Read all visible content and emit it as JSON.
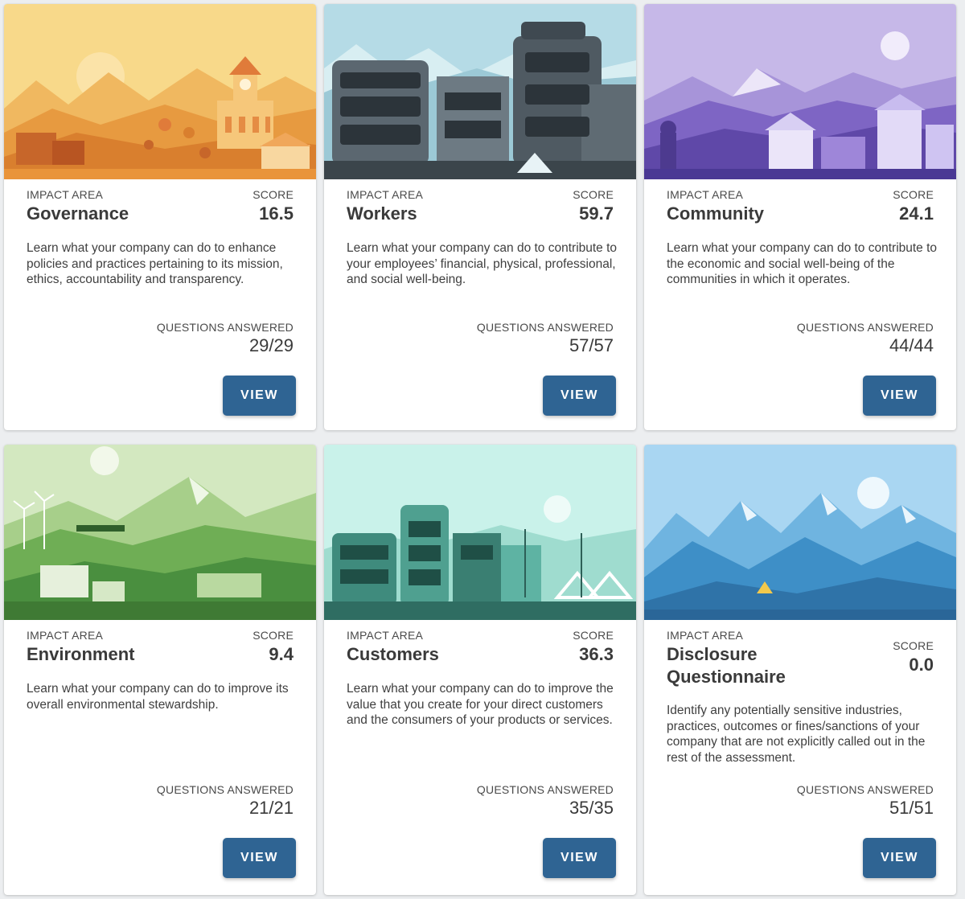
{
  "cards": [
    {
      "area_label": "IMPACT AREA",
      "title": "Governance",
      "score_label": "SCORE",
      "score": "16.5",
      "description": "Learn what your company can do to enhance policies and practices pertaining to its mission, ethics, accountability and transparency.",
      "questions_label": "QUESTIONS ANSWERED",
      "questions": "29/29",
      "button": "VIEW",
      "illustration": "town-hall-illustration"
    },
    {
      "area_label": "IMPACT AREA",
      "title": "Workers",
      "score_label": "SCORE",
      "score": "59.7",
      "description": "Learn what your company can do to contribute to your employees’ financial, physical, professional, and social well-being.",
      "questions_label": "QUESTIONS ANSWERED",
      "questions": "57/57",
      "button": "VIEW",
      "illustration": "office-buildings-illustration"
    },
    {
      "area_label": "IMPACT AREA",
      "title": "Community",
      "score_label": "SCORE",
      "score": "24.1",
      "description": "Learn what your company can do to contribute to the economic and social well-being of the communities in which it operates.",
      "questions_label": "QUESTIONS ANSWERED",
      "questions": "44/44",
      "button": "VIEW",
      "illustration": "village-illustration"
    },
    {
      "area_label": "IMPACT AREA",
      "title": "Environment",
      "score_label": "SCORE",
      "score": "9.4",
      "description": "Learn what your company can do to improve its overall environmental stewardship.",
      "questions_label": "QUESTIONS ANSWERED",
      "questions": "21/21",
      "button": "VIEW",
      "illustration": "wind-farm-illustration"
    },
    {
      "area_label": "IMPACT AREA",
      "title": "Customers",
      "score_label": "SCORE",
      "score": "36.3",
      "description": "Learn what your company can do to improve the value that you create for your direct customers and the consumers of your products or services.",
      "questions_label": "QUESTIONS ANSWERED",
      "questions": "35/35",
      "button": "VIEW",
      "illustration": "market-street-illustration"
    },
    {
      "area_label": "IMPACT AREA",
      "title": "Disclosure Questionnaire",
      "score_label": "SCORE",
      "score": "0.0",
      "description": "Identify any potentially sensitive industries, practices, outcomes or fines/sanctions of your company that are not explicitly called out in the rest of the assessment.",
      "questions_label": "QUESTIONS ANSWERED",
      "questions": "51/51",
      "button": "VIEW",
      "illustration": "mountains-illustration"
    }
  ],
  "colors": {
    "button": "#2f6493",
    "governance": "#f3b95f",
    "workers": "#a8d4e2",
    "community": "#b9a9e0",
    "environment": "#c7e0ad",
    "customers": "#bfeee6",
    "disclosure": "#9fd0ef"
  }
}
